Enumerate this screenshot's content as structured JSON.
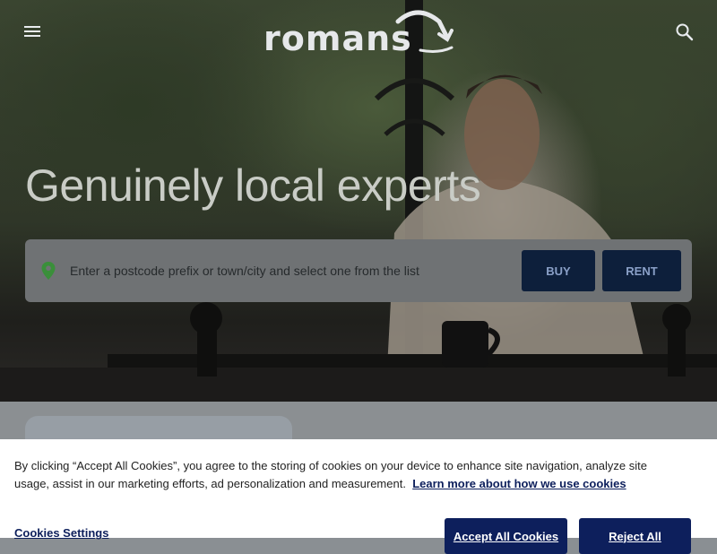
{
  "header": {
    "logo_text": "romans",
    "menu_icon": "menu-icon",
    "search_icon": "search-icon"
  },
  "hero": {
    "headline": "Genuinely local experts",
    "search": {
      "placeholder": "Enter a postcode prefix or town/city and select one from the list",
      "pin_icon": "location-pin-icon",
      "pin_color": "#3a8f3a"
    },
    "buy_label": "BUY",
    "rent_label": "RENT"
  },
  "cookie_banner": {
    "text": "By clicking “Accept All Cookies”, you agree to the storing of cookies on your device to enhance site navigation, analyze site usage, assist in our marketing efforts, ad personalization and measurement.",
    "learn_more": "Learn more about how we use cookies",
    "settings_label": "Cookies Settings",
    "accept_label": "Accept All Cookies",
    "reject_label": "Reject All"
  },
  "colors": {
    "brand_navy": "#0d1f5c",
    "button_dark": "#0d1f3b"
  }
}
